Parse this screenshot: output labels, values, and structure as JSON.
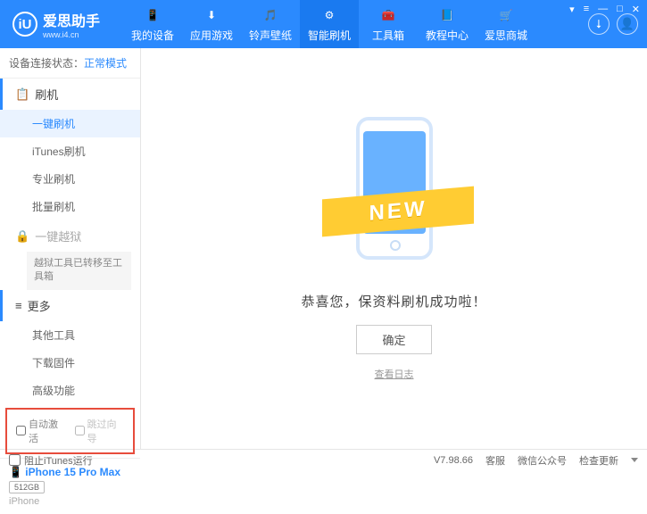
{
  "app": {
    "name": "爱思助手",
    "site": "www.i4.cn",
    "logo_letter": "iU"
  },
  "win_controls": [
    "▾",
    "≡",
    "—",
    "□",
    "✕"
  ],
  "nav": [
    {
      "label": "我的设备",
      "icon": "📱"
    },
    {
      "label": "应用游戏",
      "icon": "⬇"
    },
    {
      "label": "铃声壁纸",
      "icon": "🎵"
    },
    {
      "label": "智能刷机",
      "icon": "⚙",
      "active": true
    },
    {
      "label": "工具箱",
      "icon": "🧰"
    },
    {
      "label": "教程中心",
      "icon": "📘"
    },
    {
      "label": "爱思商城",
      "icon": "🛒"
    }
  ],
  "status": {
    "label": "设备连接状态：",
    "value": "正常模式"
  },
  "sidebar": {
    "groups": [
      {
        "title": "刷机",
        "icon": "📋",
        "items": [
          {
            "label": "一键刷机",
            "active": true
          },
          {
            "label": "iTunes刷机"
          },
          {
            "label": "专业刷机"
          },
          {
            "label": "批量刷机"
          }
        ]
      },
      {
        "title": "一键越狱",
        "icon": "🔒",
        "locked": true,
        "items": [
          {
            "label": "越狱工具已转移至工具箱",
            "boxed": true
          }
        ]
      },
      {
        "title": "更多",
        "icon": "≡",
        "items": [
          {
            "label": "其他工具"
          },
          {
            "label": "下载固件"
          },
          {
            "label": "高级功能"
          }
        ]
      }
    ],
    "checkboxes": [
      {
        "label": "自动激活",
        "checked": false
      },
      {
        "label": "跳过向导",
        "checked": false
      }
    ]
  },
  "device": {
    "name": "iPhone 15 Pro Max",
    "storage": "512GB",
    "type": "iPhone",
    "icon": "📱"
  },
  "main": {
    "new_label": "NEW",
    "success": "恭喜您，保资料刷机成功啦！",
    "ok": "确定",
    "log_link": "查看日志"
  },
  "footer": {
    "block_itunes": "阻止iTunes运行",
    "version": "V7.98.66",
    "links": [
      "客服",
      "微信公众号",
      "检查更新"
    ]
  }
}
